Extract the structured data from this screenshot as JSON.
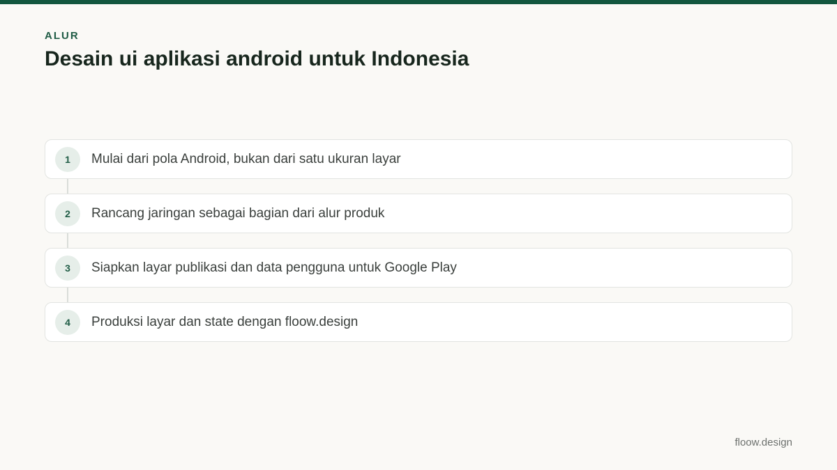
{
  "header": {
    "eyebrow": "ALUR",
    "title": "Desain ui aplikasi android untuk Indonesia"
  },
  "steps": [
    {
      "number": "1",
      "text": "Mulai dari pola Android, bukan dari satu ukuran layar"
    },
    {
      "number": "2",
      "text": "Rancang jaringan sebagai bagian dari alur produk"
    },
    {
      "number": "3",
      "text": "Siapkan layar publikasi dan data pengguna untuk Google Play"
    },
    {
      "number": "4",
      "text": "Produksi layar dan state dengan floow.design"
    }
  ],
  "footer": {
    "brand": "floow.design"
  },
  "colors": {
    "accent": "#13573f",
    "badge_bg": "#e6eee9",
    "background": "#faf9f6"
  }
}
